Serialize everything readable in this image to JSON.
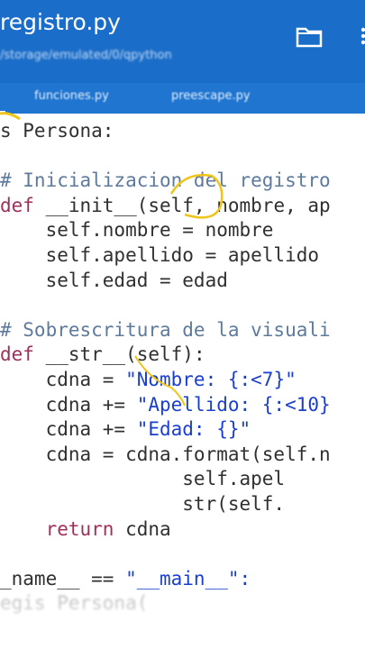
{
  "app": {
    "title": "registro.py",
    "subtitle": "/storage/emulated/0/qpython",
    "icons": [
      "folder-icon",
      "more-icon"
    ],
    "colors": {
      "appbar": "#1a6dc8",
      "tabbar": "#1f75d0",
      "keyword": "#a0305a",
      "comment": "#5e7a9c",
      "string": "#1a3fd0"
    }
  },
  "tabs": [
    {
      "label": ""
    },
    {
      "label": "funciones.py"
    },
    {
      "label": "preescape.py"
    }
  ],
  "code": {
    "lines": [
      [
        {
          "t": "s Persona:",
          "c": "pl"
        }
      ],
      [],
      [
        {
          "t": "# Inicializacion del registro",
          "c": "cm"
        }
      ],
      [
        {
          "t": "def ",
          "c": "kw"
        },
        {
          "t": "__init__(self, nombre, ap",
          "c": "pl"
        }
      ],
      [
        {
          "t": "    self.nombre = nombre",
          "c": "pl"
        }
      ],
      [
        {
          "t": "    self.apellido = apellido",
          "c": "pl"
        }
      ],
      [
        {
          "t": "    self.edad = edad",
          "c": "pl"
        }
      ],
      [],
      [
        {
          "t": "# Sobrescritura de la visuali",
          "c": "cm"
        }
      ],
      [
        {
          "t": "def ",
          "c": "kw"
        },
        {
          "t": "__str__(self):",
          "c": "pl"
        }
      ],
      [
        {
          "t": "    cdna = ",
          "c": "pl"
        },
        {
          "t": "\"Nombre: {:<7}\"",
          "c": "str"
        }
      ],
      [
        {
          "t": "    cdna += ",
          "c": "pl"
        },
        {
          "t": "\"Apellido: {:<10}",
          "c": "str"
        }
      ],
      [
        {
          "t": "    cdna += ",
          "c": "pl"
        },
        {
          "t": "\"Edad: {}\"",
          "c": "str"
        }
      ],
      [
        {
          "t": "    cdna = cdna.format(self.n",
          "c": "pl"
        }
      ],
      [
        {
          "t": "                self.apel",
          "c": "pl"
        }
      ],
      [
        {
          "t": "                str(self.",
          "c": "pl"
        }
      ],
      [
        {
          "t": "    return ",
          "c": "kw"
        },
        {
          "t": "cdna",
          "c": "pl"
        }
      ],
      [],
      [
        {
          "t": "_name__ == ",
          "c": "pl"
        },
        {
          "t": "\"__main__\":",
          "c": "str"
        }
      ],
      [
        {
          "t": "egis Persona(",
          "c": "pl"
        }
      ]
    ]
  }
}
